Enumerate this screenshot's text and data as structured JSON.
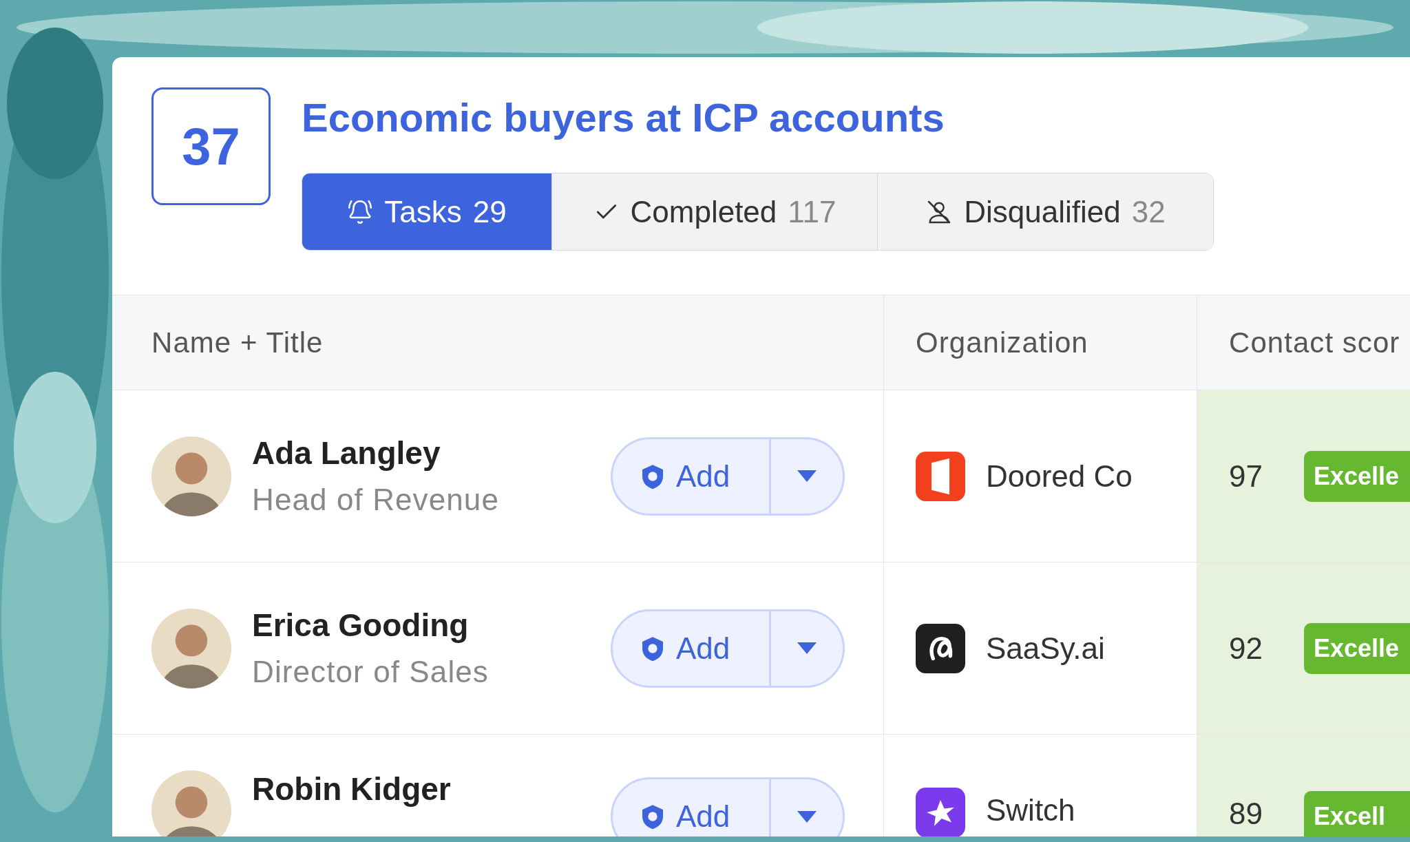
{
  "count": "37",
  "title": "Economic buyers at ICP accounts",
  "tabs": [
    {
      "label": "Tasks",
      "count": "29",
      "selected": true
    },
    {
      "label": "Completed",
      "count": "117",
      "selected": false
    },
    {
      "label": "Disqualified",
      "count": "32",
      "selected": false
    }
  ],
  "table": {
    "columns": [
      "Name + Title",
      "Organization",
      "Contact scor"
    ],
    "rows": [
      {
        "name": "Ada Langley",
        "title": "Head of Revenue",
        "action": "Add",
        "organization": "Doored Co",
        "color": "#f2401e",
        "score": "97",
        "rating": "Excelle"
      },
      {
        "name": "Erica Gooding",
        "title": "Director of Sales",
        "action": "Add",
        "organization": "SaaSy.ai",
        "color": "#1f1f1f",
        "score": "92",
        "rating": "Excelle"
      },
      {
        "name": "Robin Kidger",
        "action": "Add",
        "organization": "Switch",
        "color": "#7c3aed",
        "score": "89",
        "rating": "Excell"
      }
    ]
  }
}
